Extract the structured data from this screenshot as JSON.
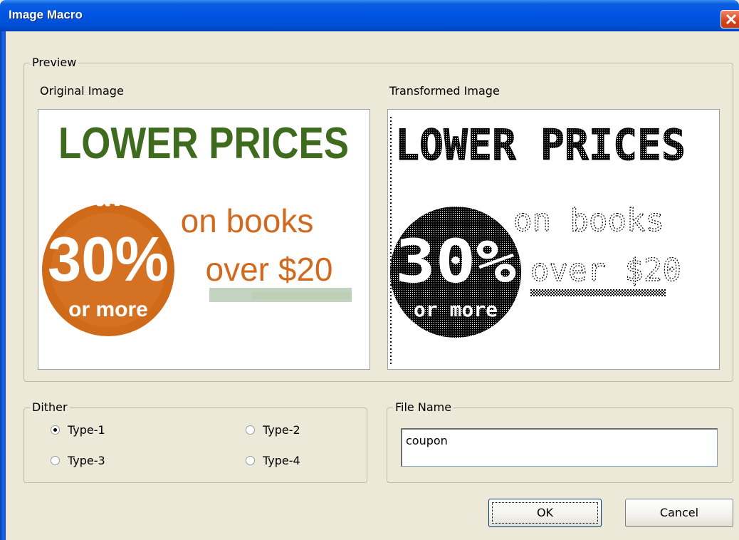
{
  "window": {
    "title": "Image Macro"
  },
  "preview": {
    "legend": "Preview",
    "original_label": "Original Image",
    "transformed_label": "Transformed Image",
    "ad": {
      "headline": "LOWER PRICES",
      "save": "Save",
      "percent": "30%",
      "or_more": "or more",
      "line1": "on books",
      "line2": "over $20"
    }
  },
  "dither": {
    "legend": "Dither",
    "options": [
      "Type-1",
      "Type-2",
      "Type-3",
      "Type-4"
    ],
    "selected": "Type-1"
  },
  "file_name": {
    "legend": "File Name",
    "value": "coupon"
  },
  "buttons": {
    "ok": "OK",
    "cancel": "Cancel"
  },
  "colors": {
    "title_bar": "#0054e3",
    "headline_green": "#3e6b1d",
    "badge_orange": "#d2691e"
  }
}
